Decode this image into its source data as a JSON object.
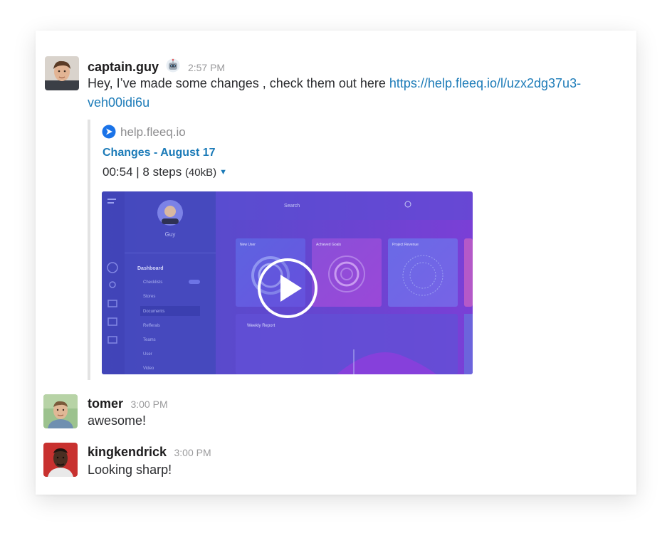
{
  "messages": [
    {
      "username": "captain.guy",
      "timestamp": "2:57 PM",
      "text": "Hey, I’ve made some changes , check them out here ",
      "link_part1": "https://help.fleeq.io/l/uzx2dg37u3-",
      "link_part2": "veh00idi6u"
    },
    {
      "username": "tomer",
      "timestamp": "3:00 PM",
      "text": "awesome!"
    },
    {
      "username": "kingkendrick",
      "timestamp": "3:00 PM",
      "text": "Looking sharp!"
    }
  ],
  "attachment": {
    "site": "help.fleeq.io",
    "title": "Changes - August 17",
    "meta": "00:54 | 8 steps ",
    "size": "(40kB)",
    "preview": {
      "profile_name": "Guy",
      "search": "Search",
      "menu_header": "Dashboard",
      "menu_items": [
        "Checklists",
        "Stores",
        "Documents",
        "Refferals",
        "Teams",
        "User",
        "Video"
      ],
      "cards": [
        "New User",
        "Achieved Goals",
        "Project Revenue"
      ],
      "report_title": "Weekly Report"
    }
  },
  "colors": {
    "link": "#1c7bb8",
    "site_icon": "#1a73e8",
    "video_left": "#4a4fc7",
    "video_right": "#7a3fd6"
  }
}
